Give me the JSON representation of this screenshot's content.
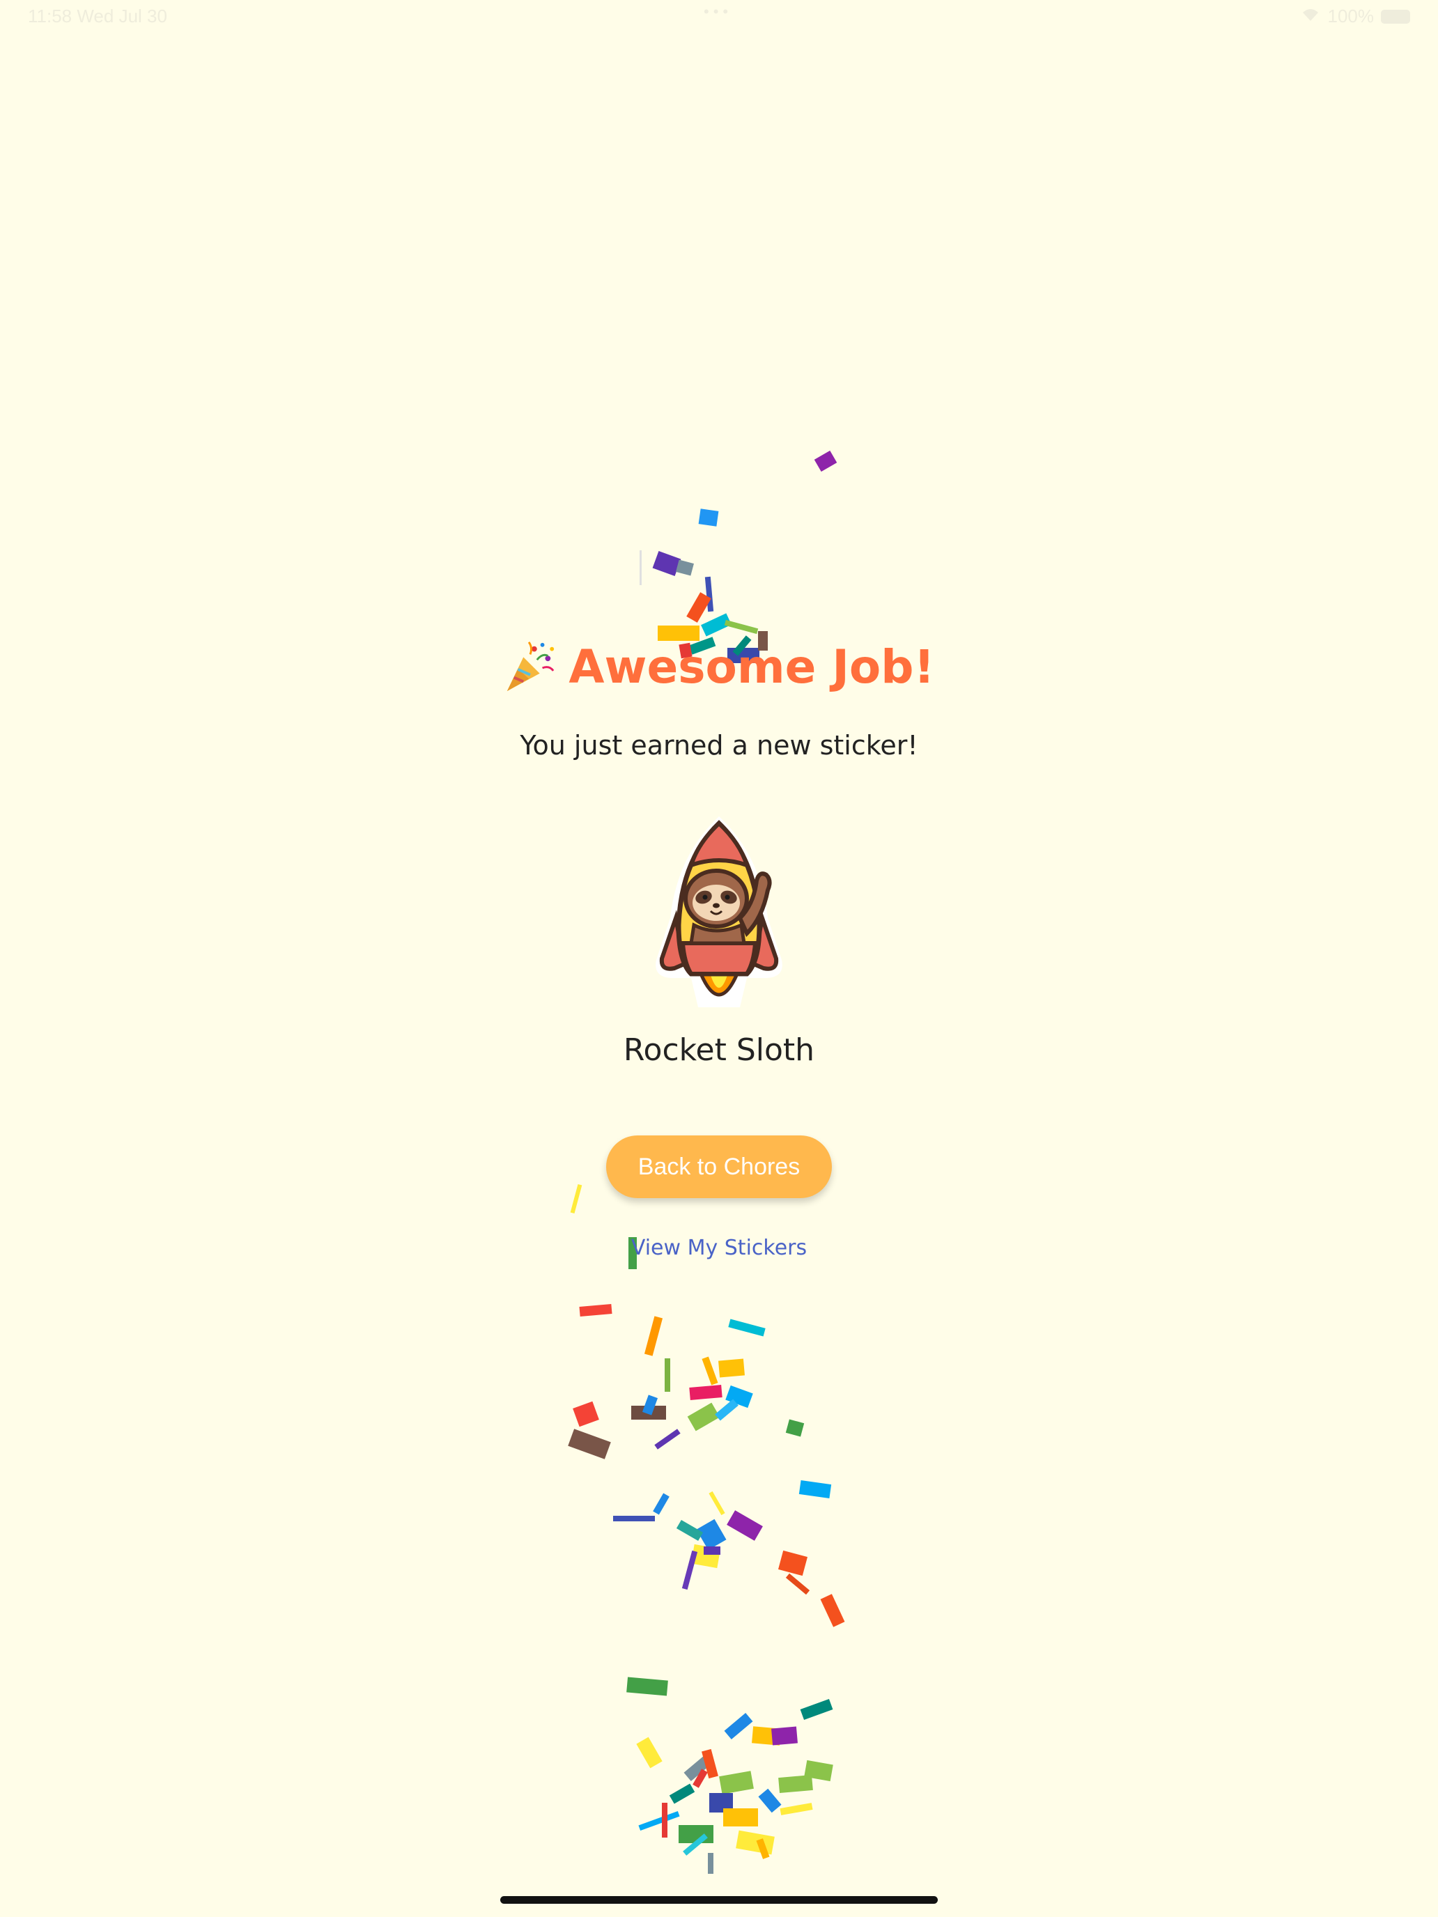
{
  "status_bar": {
    "time": "11:58  Wed Jul 30",
    "dots": "•••",
    "battery": "100%",
    "wifi_icon": "wifi-icon",
    "battery_icon": "battery-icon"
  },
  "celebration": {
    "icon": "party-popper-icon",
    "title": "Awesome Job!",
    "subtitle": "You just earned a new sticker!"
  },
  "sticker": {
    "image": "rocket-sloth-sticker",
    "name": "Rocket Sloth"
  },
  "actions": {
    "back_label": "Back to Chores",
    "view_stickers_label": "View My Stickers"
  },
  "colors": {
    "background": "#FFFDE8",
    "title": "#FF6F3C",
    "button": "#FFB84D",
    "link": "#4A63C7"
  }
}
